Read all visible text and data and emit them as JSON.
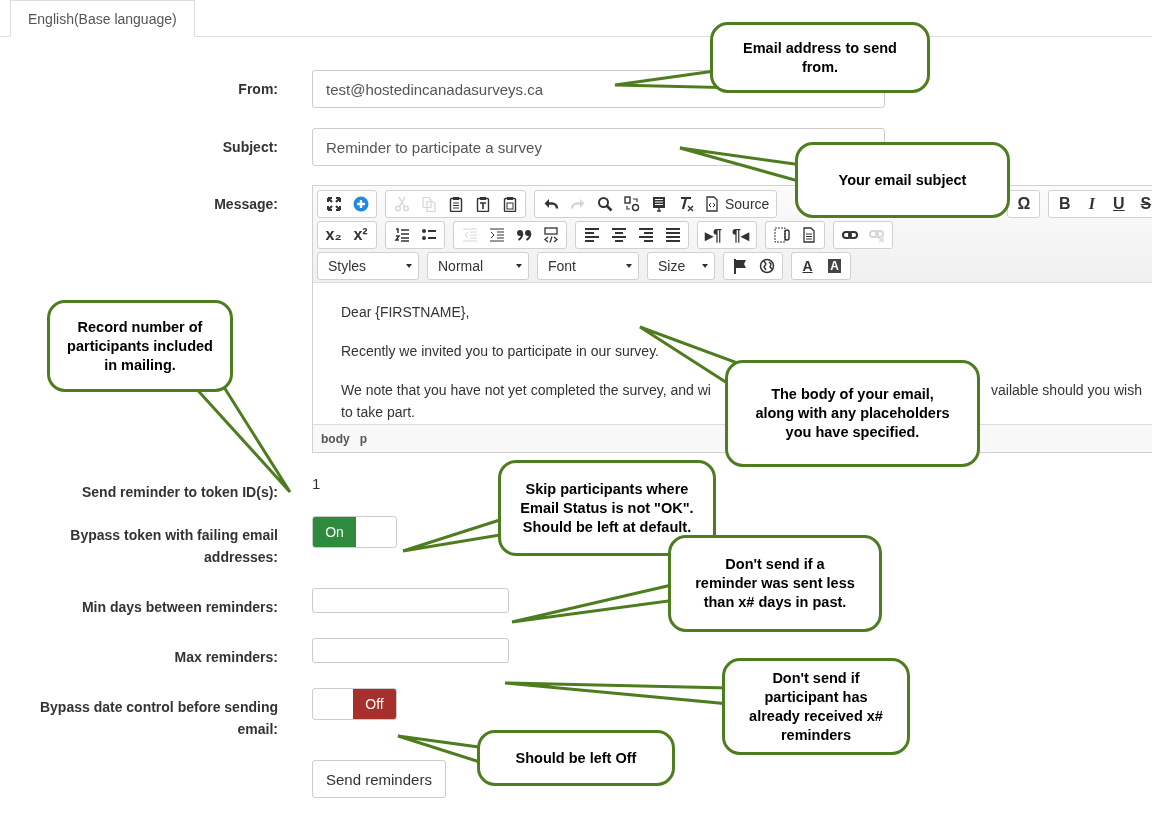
{
  "tabs": [
    {
      "label": "English(Base language)",
      "selected": true
    }
  ],
  "from": {
    "label": "From:",
    "value": "test@hostedincanadasurveys.ca"
  },
  "subject": {
    "label": "Subject:",
    "value": "Reminder to participate a survey"
  },
  "message": {
    "label": "Message:",
    "toolbar": [
      {
        "groups": [
          [
            {
              "kind": "maximize",
              "disabled": false
            },
            {
              "kind": "add",
              "disabled": false
            }
          ],
          [
            {
              "kind": "cut",
              "disabled": true
            },
            {
              "kind": "copy",
              "disabled": true
            },
            {
              "kind": "paste",
              "disabled": false
            },
            {
              "kind": "paste-text",
              "disabled": false
            },
            {
              "kind": "paste-word",
              "disabled": false
            }
          ],
          [
            {
              "kind": "undo",
              "disabled": false
            },
            {
              "kind": "redo",
              "disabled": true
            },
            {
              "kind": "find",
              "disabled": false
            },
            {
              "kind": "replace",
              "disabled": false
            },
            {
              "kind": "select-all",
              "disabled": false
            },
            {
              "kind": "remove-format",
              "disabled": false
            },
            {
              "kind": "source",
              "disabled": false,
              "label": "Source"
            }
          ]
        ],
        "right_groups": [
          [
            {
              "kind": "glyph",
              "glyph": "Ω",
              "disabled": false
            }
          ],
          [
            {
              "kind": "bold",
              "glyph": "B",
              "disabled": false
            },
            {
              "kind": "italic",
              "glyph": "I",
              "disabled": false
            },
            {
              "kind": "underline",
              "glyph": "U",
              "disabled": false
            },
            {
              "kind": "strike",
              "glyph": "S",
              "disabled": false
            }
          ]
        ]
      },
      {
        "groups": [
          [
            {
              "kind": "glyph",
              "glyph": "x₂",
              "disabled": false
            },
            {
              "kind": "glyph",
              "glyph": "x²",
              "disabled": false
            }
          ],
          [
            {
              "kind": "numbered-list",
              "disabled": false
            },
            {
              "kind": "bulleted-list",
              "disabled": false
            }
          ],
          [
            {
              "kind": "outdent",
              "disabled": true
            },
            {
              "kind": "indent",
              "disabled": false
            },
            {
              "kind": "blockquote",
              "disabled": false
            },
            {
              "kind": "div",
              "disabled": false
            }
          ],
          [
            {
              "kind": "align-left",
              "disabled": false
            },
            {
              "kind": "align-center",
              "disabled": false
            },
            {
              "kind": "align-right",
              "disabled": false
            },
            {
              "kind": "justify",
              "disabled": false
            }
          ],
          [
            {
              "kind": "glyph",
              "glyph": "▸¶",
              "disabled": false
            },
            {
              "kind": "glyph",
              "glyph": "¶◂",
              "disabled": false
            }
          ],
          [
            {
              "kind": "iframe",
              "disabled": false
            },
            {
              "kind": "page",
              "disabled": false
            }
          ],
          [
            {
              "kind": "link",
              "disabled": false
            },
            {
              "kind": "unlink",
              "disabled": true
            }
          ]
        ]
      }
    ],
    "dropdowns": [
      {
        "label": "Styles"
      },
      {
        "label": "Normal"
      },
      {
        "label": "Font"
      },
      {
        "label": "Size"
      }
    ],
    "extra_buttons": [
      [
        {
          "kind": "flag",
          "disabled": false
        },
        {
          "kind": "globe",
          "disabled": false
        }
      ],
      [
        {
          "kind": "text-color",
          "glyph": "A",
          "disabled": false
        },
        {
          "kind": "bg-color",
          "glyph": "A",
          "disabled": false
        }
      ]
    ],
    "body": [
      {
        "lines": [
          [
            "Dear {FIRSTNAME},"
          ]
        ]
      },
      {
        "lines": [
          [
            "Recently we invited you to participate in our survey."
          ]
        ]
      },
      {
        "lines": [
          [
            "We note that you have not yet completed the survey, and wi",
            "vailable should you wish"
          ],
          [
            "to take part."
          ]
        ]
      }
    ],
    "path": [
      "body",
      "p"
    ]
  },
  "fields": [
    {
      "kind": "static",
      "label": "Send reminder to token ID(s):",
      "value": "1"
    },
    {
      "kind": "toggle",
      "label": "Bypass token with failing email addresses:",
      "on": true,
      "state_label": "On"
    },
    {
      "kind": "number",
      "label": "Min days between reminders:"
    },
    {
      "kind": "number",
      "label": "Max reminders:"
    },
    {
      "kind": "toggle",
      "label": "Bypass date control before sending email:",
      "on": false,
      "state_label": "Off"
    }
  ],
  "submit": "Send reminders",
  "callouts": [
    {
      "text": "Email address to send from."
    },
    {
      "text": "Your email subject"
    },
    {
      "text": "Record number of participants included in mailing."
    },
    {
      "text": "The body of your email, along with any placeholders you have specified."
    },
    {
      "text": "Skip participants where Email Status is not \"OK\". Should be left at default."
    },
    {
      "text": "Don't send if a reminder was sent less than x# days in past."
    },
    {
      "text": "Don't send if participant has already received x# reminders"
    },
    {
      "text": "Should be left Off"
    }
  ]
}
